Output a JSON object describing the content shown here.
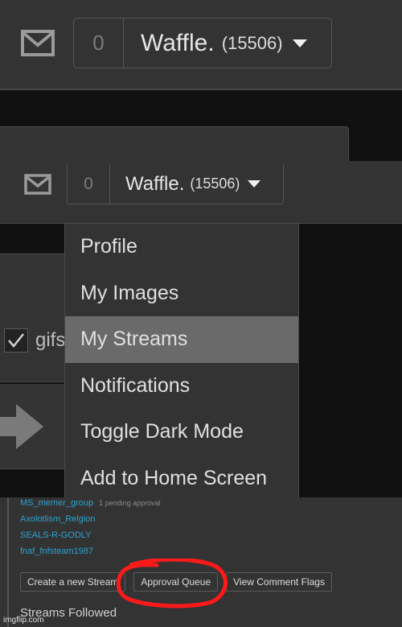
{
  "header_large": {
    "mail_icon": "envelope-icon",
    "notification_count": "0",
    "username": "Waffle.",
    "points": "(15506)",
    "caret_icon": "caret-down-icon"
  },
  "header_small": {
    "mail_icon": "envelope-icon",
    "notification_count": "0",
    "username": "Waffle.",
    "points": "(15506)",
    "caret_icon": "caret-down-icon"
  },
  "background": {
    "gif_checkbox_label": "gifs",
    "gif_checkbox_checked": true,
    "arrow_icon": "arrow-right-icon"
  },
  "user_menu": {
    "items": [
      {
        "label": "Profile",
        "active": false
      },
      {
        "label": "My Images",
        "active": false
      },
      {
        "label": "My Streams",
        "active": true
      },
      {
        "label": "Notifications",
        "active": false
      },
      {
        "label": "Toggle Dark Mode",
        "active": false
      },
      {
        "label": "Add to Home Screen",
        "active": false
      }
    ]
  },
  "streams": {
    "items": [
      {
        "name": "MS_memer_group",
        "note": "1 pending approval"
      },
      {
        "name": "Axolotlism_Relgion",
        "note": ""
      },
      {
        "name": "SEALS-R-GODLY",
        "note": ""
      },
      {
        "name": "fnaf_fnfsteam1987",
        "note": ""
      }
    ],
    "buttons": {
      "create": "Create a new Stream",
      "approval": "Approval Queue",
      "flags": "View Comment Flags"
    },
    "followed_title": "Streams Followed"
  },
  "annotation": {
    "color": "#ff1a1a",
    "target": "Approval Queue"
  },
  "colors": {
    "link": "#2aa3cf",
    "menu_active_bg": "#6a6a6a",
    "panel_bg": "#333333"
  },
  "watermark": "imgflip.com"
}
